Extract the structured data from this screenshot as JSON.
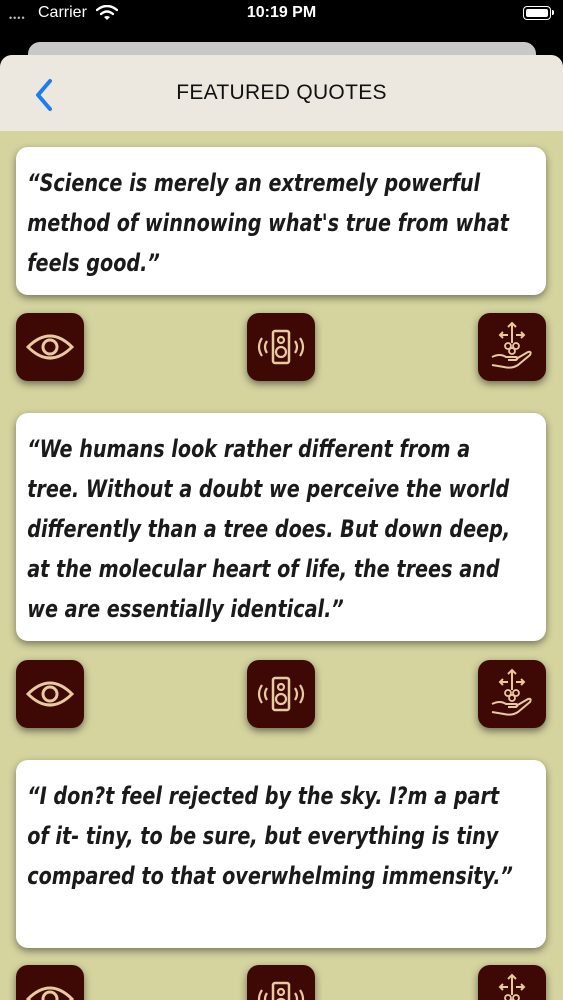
{
  "status_bar": {
    "carrier": "Carrier",
    "time": "10:19 PM"
  },
  "nav": {
    "title": "FEATURED QUOTES",
    "back_icon": "chevron-left-icon",
    "accent": "#1f7cf0"
  },
  "colors": {
    "background": "#d5d49f",
    "card": "#ffffff",
    "button": "#3e0905",
    "icon_stroke": "#e9c9a0"
  },
  "quotes": [
    {
      "text": "“Science is merely an extremely powerful method of winnowing what's true from what feels good.”",
      "actions": [
        "eye-icon",
        "speaker-icon",
        "share-hand-icon"
      ]
    },
    {
      "text": "“We humans look rather different from a tree. Without a doubt we perceive the world differently than a tree does. But down deep, at the molecular heart of life, the trees and we are essentially identical.”",
      "actions": [
        "eye-icon",
        "speaker-icon",
        "share-hand-icon"
      ]
    },
    {
      "text": "“I don?t feel rejected by the sky. I?m a part of it- tiny, to be sure, but everything is tiny compared to that overwhelming immensity.”",
      "actions": [
        "eye-icon",
        "speaker-icon",
        "share-hand-icon"
      ]
    }
  ]
}
